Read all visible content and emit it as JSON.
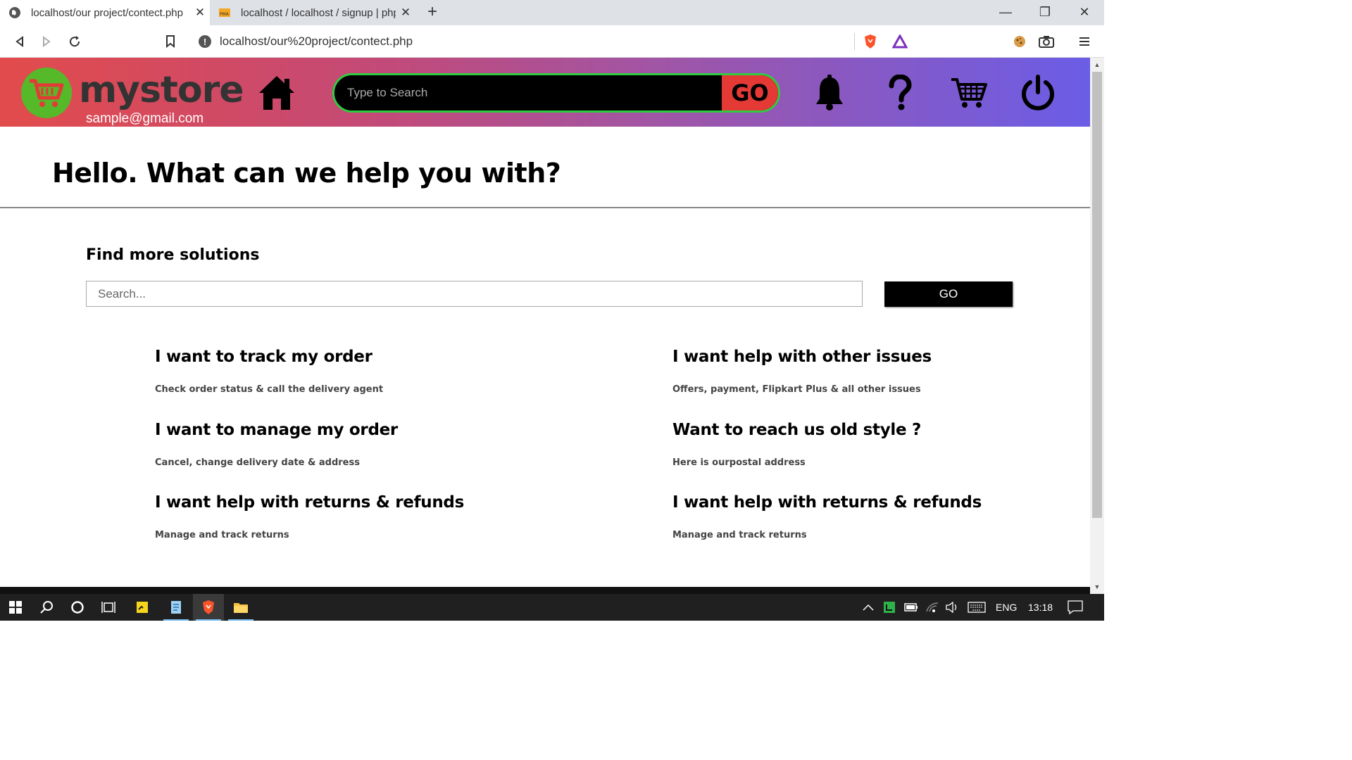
{
  "browser": {
    "tabs": [
      {
        "label": "localhost/our project/contect.php",
        "active": true
      },
      {
        "label": "localhost / localhost / signup | php",
        "active": false
      }
    ],
    "url": "localhost/our%20project/contect.php"
  },
  "header": {
    "brand": "mystore",
    "email": "sample@gmail.com",
    "search_placeholder": "Type to Search",
    "search_button": "GO",
    "icons": [
      "home-icon",
      "bell-icon",
      "help-icon",
      "cart-icon",
      "power-icon"
    ]
  },
  "main": {
    "heading": "Hello. What can we help you with?",
    "subheading": "Find more solutions",
    "search_placeholder": "Search...",
    "search_button": "GO",
    "options": [
      {
        "title": "I want to track my order",
        "desc": "Check order status & call the delivery agent"
      },
      {
        "title": "I want help with other issues",
        "desc": "Offers, payment, Flipkart Plus & all other issues"
      },
      {
        "title": "I want to manage my order",
        "desc": "Cancel, change delivery date & address"
      },
      {
        "title": "Want to reach us old style ?",
        "desc": "Here is ourpostal address"
      },
      {
        "title": "I want help with returns & refunds",
        "desc": "Manage and track returns"
      },
      {
        "title": "I want help with returns & refunds",
        "desc": "Manage and track returns"
      }
    ]
  },
  "taskbar": {
    "language": "ENG",
    "time": "13:18"
  },
  "colors": {
    "header_gradient_start": "#e24b4b",
    "header_gradient_end": "#6b5de6",
    "logo_green": "#55b92a",
    "search_border": "#2ecc40",
    "search_go": "#e53935"
  }
}
